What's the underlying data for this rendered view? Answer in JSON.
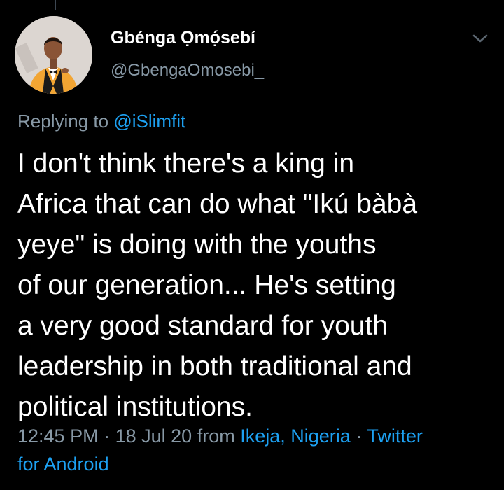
{
  "author": {
    "name": "Gbénga Ọmọ́sebí",
    "handle": "@GbengaOmosebi_",
    "avatar_icon": "profile-photo"
  },
  "menu": {
    "icon": "chevron-down-icon"
  },
  "reply": {
    "prefix": "Replying to",
    "mention": "@iSlimfit"
  },
  "tweet": {
    "lines": [
      "I don't think there's a king in",
      "Africa that can do what \"Ikú bàbà",
      "yeye\" is doing with the youths",
      "of our generation... He's setting",
      "a very good standard for youth",
      "leadership in both traditional and",
      "political institutions."
    ]
  },
  "meta": {
    "time": "12:45 PM",
    "separator": "·",
    "date": "18 Jul 20",
    "from_label": "from",
    "location": "Ikeja, Nigeria",
    "client_line1": "Twitter",
    "client_line2": "for Android"
  },
  "colors": {
    "background": "#000000",
    "text": "#ffffff",
    "secondary": "#8899a6",
    "accent": "#1da1f2",
    "suit": "#f2a533"
  }
}
